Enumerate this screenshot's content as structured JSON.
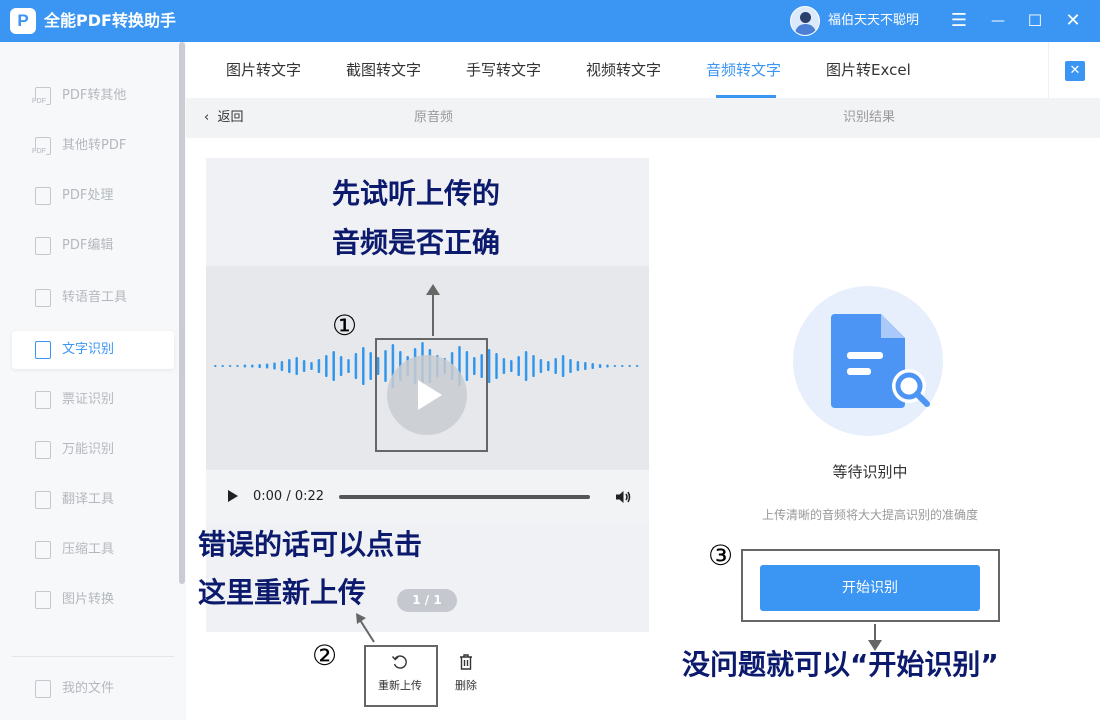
{
  "app": {
    "title": "全能PDF转换助手",
    "logo_glyph": "P",
    "username": "福伯天天不聪明"
  },
  "window_controls": {
    "menu": "☰",
    "minimize": "—",
    "maximize": "☐",
    "close": "✕"
  },
  "sidebar": {
    "items": [
      {
        "label": "PDF转其他",
        "icon": "pdf-export-icon",
        "tag": "PDF"
      },
      {
        "label": "其他转PDF",
        "icon": "pdf-import-icon",
        "tag": "PDF"
      },
      {
        "label": "PDF处理",
        "icon": "pdf-process-icon",
        "tag": ""
      },
      {
        "label": "PDF编辑",
        "icon": "pdf-edit-icon",
        "tag": ""
      },
      {
        "label": "转语音工具",
        "icon": "text-to-speech-icon",
        "tag": ""
      },
      {
        "label": "文字识别",
        "icon": "ocr-icon",
        "tag": "",
        "active": true
      },
      {
        "label": "票证识别",
        "icon": "ticket-ocr-icon",
        "tag": ""
      },
      {
        "label": "万能识别",
        "icon": "universal-ocr-icon",
        "tag": ""
      },
      {
        "label": "翻译工具",
        "icon": "translate-icon",
        "tag": ""
      },
      {
        "label": "压缩工具",
        "icon": "compress-icon",
        "tag": ""
      },
      {
        "label": "图片转换",
        "icon": "image-convert-icon",
        "tag": ""
      },
      {
        "label": "我的文件",
        "icon": "my-files-icon",
        "tag": ""
      }
    ]
  },
  "tabs": [
    {
      "label": "图片转文字"
    },
    {
      "label": "截图转文字"
    },
    {
      "label": "手写转文字"
    },
    {
      "label": "视频转文字"
    },
    {
      "label": "音频转文字",
      "active": true
    },
    {
      "label": "图片转Excel"
    }
  ],
  "subheader": {
    "back": "返回",
    "left_title": "原音频",
    "right_title": "识别结果"
  },
  "player": {
    "time": "0:00 / 0:22"
  },
  "pagination": "1 / 1",
  "actions": {
    "reupload": "重新上传",
    "delete": "删除"
  },
  "result": {
    "status": "等待识别中",
    "hint": "上传清晰的音频将大大提高识别的准确度",
    "start_button": "开始识别"
  },
  "annotations": {
    "top_line1": "先试听上传的",
    "top_line2": "音频是否正确",
    "left_line1": "错误的话可以点击",
    "left_line2": "这里重新上传",
    "right_text": "没问题就可以“开始识别”",
    "num1": "①",
    "num2": "②",
    "num3": "③"
  },
  "colors": {
    "accent": "#3b95f3",
    "annotation_text": "#0c1a6e"
  }
}
